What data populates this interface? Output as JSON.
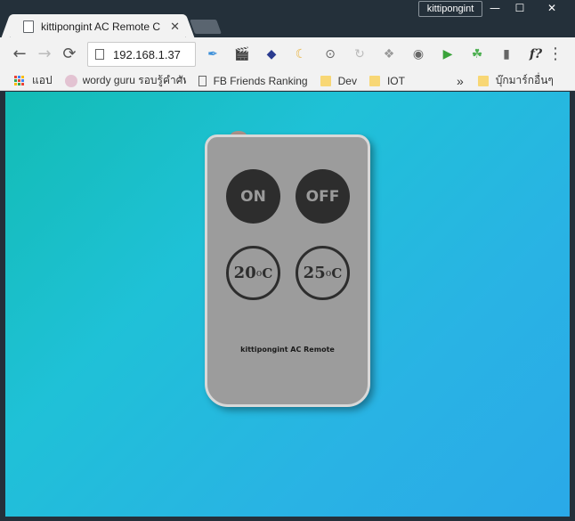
{
  "window": {
    "profile_name": "kittipongint",
    "minimize": "—",
    "maximize": "☐",
    "close": "✕"
  },
  "tab": {
    "title": "kittipongint AC Remote C",
    "close": "✕"
  },
  "toolbar": {
    "back": "←",
    "forward": "→",
    "reload": "⟳",
    "url": "192.168.1.37",
    "menu": "⋮",
    "extensions": [
      "✒",
      "🎬",
      "◆",
      "☾",
      "⊙",
      "↻",
      "❖",
      "◉",
      "▶",
      "☘",
      "▮",
      "f?"
    ]
  },
  "bookmarks": {
    "apps": "แอป",
    "items": [
      {
        "label": "wordy guru รอบรู้คำศัพ",
        "icon": "wordy"
      },
      {
        "label": "FB Friends Ranking",
        "icon": "page"
      },
      {
        "label": "Dev",
        "icon": "folder"
      },
      {
        "label": "IOT",
        "icon": "folder"
      }
    ],
    "overflow": "»",
    "other": "บุ๊กมาร์กอื่นๆ"
  },
  "remote": {
    "on": "ON",
    "off": "OFF",
    "temp1": "20",
    "temp2": "25",
    "degree": "o",
    "unit": "C",
    "label": "kittipongint AC Remote"
  }
}
